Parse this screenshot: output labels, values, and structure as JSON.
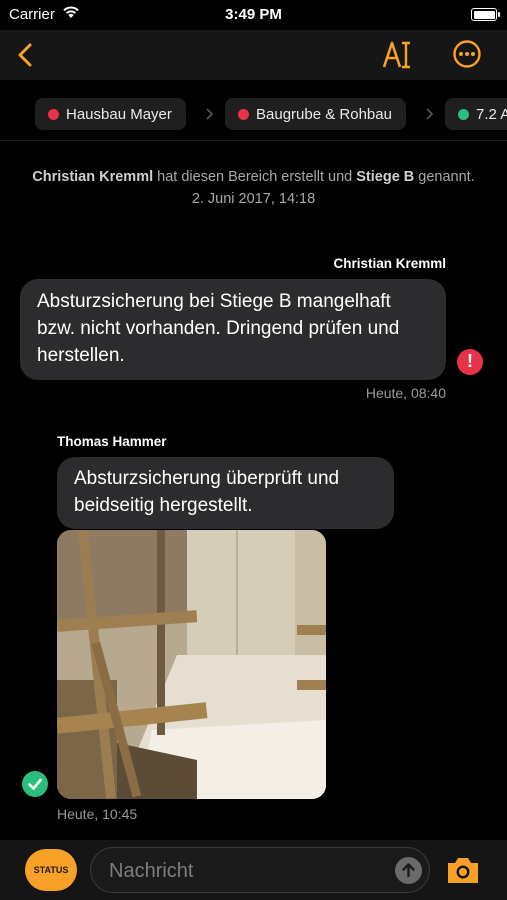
{
  "status_bar": {
    "carrier": "Carrier",
    "time": "3:49 PM"
  },
  "nav": {
    "back_icon": "chevron-left-icon",
    "font_icon": "text-size-icon",
    "more_icon": "ellipsis-circle-icon"
  },
  "breadcrumbs": [
    {
      "label": "Hausbau Mayer",
      "dot_color": "#e8334a"
    },
    {
      "label": "Baugrube & Rohbau",
      "dot_color": "#e8334a"
    },
    {
      "label": "7.2 A",
      "dot_color": "#2bbf7f"
    }
  ],
  "system_message": {
    "author": "Christian Kremml",
    "text_middle": " hat diesen Bereich erstellt und ",
    "area": "Stiege B",
    "text_end": " genannt.",
    "date": "2. Juni 2017, 14:18"
  },
  "messages": [
    {
      "sender": "Christian Kremml",
      "text": "Absturzsicherung bei Stiege B mangelhaft bzw. nicht vorhanden. Dringend prüfen und herstellen.",
      "time": "Heute, 08:40",
      "status_icon": "alert-icon",
      "status_color": "#e8334a"
    },
    {
      "sender": "Thomas Hammer",
      "text": "Absturzsicherung überprüft und beidseitig hergestellt.",
      "time": "Heute, 10:45",
      "status_icon": "check-icon",
      "status_color": "#2bbf7f",
      "has_photo": true
    }
  ],
  "composer": {
    "status_label": "STATUS",
    "placeholder": "Nachricht",
    "accent": "#f7a128"
  }
}
